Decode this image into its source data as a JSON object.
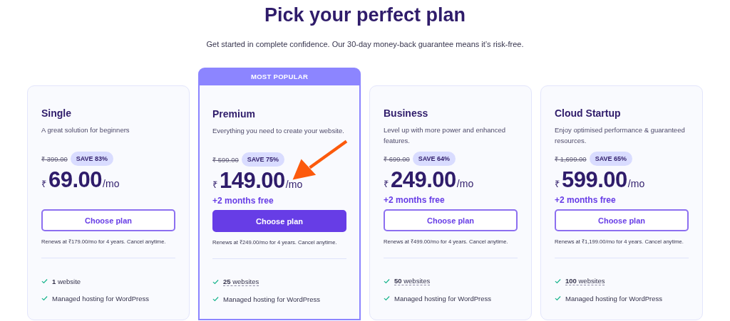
{
  "title": "Pick your perfect plan",
  "subtitle": "Get started in complete confidence. Our 30-day money-back guarantee means it’s risk-free.",
  "plans": [
    {
      "name": "Single",
      "popular": false,
      "description": "A great solution for beginners",
      "old_price": "₹ 399.00",
      "save": "SAVE 83%",
      "currency": "₹",
      "price": "69.00",
      "period": "/mo",
      "button": "Choose plan",
      "renews": "Renews at ₹179.00/mo for 4 years. Cancel anytime.",
      "features": [
        {
          "text": "**1** website",
          "underlined": false
        },
        {
          "text": "Managed hosting for WordPress",
          "underlined": false
        }
      ]
    },
    {
      "name": "Premium",
      "popular": true,
      "badge": "MOST POPULAR",
      "description": "Everything you need to create your website.",
      "old_price": "₹ 599.00",
      "save": "SAVE 75%",
      "currency": "₹",
      "price": "149.00",
      "period": "/mo",
      "bonus": "+2 months free",
      "button": "Choose plan",
      "renews": "Renews at ₹249.00/mo for 4 years. Cancel anytime.",
      "features": [
        {
          "text": "**25** websites",
          "underlined": true
        },
        {
          "text": "Managed hosting for WordPress",
          "underlined": false
        }
      ]
    },
    {
      "name": "Business",
      "popular": false,
      "description": "Level up with more power and enhanced features.",
      "old_price": "₹ 699.00",
      "save": "SAVE 64%",
      "currency": "₹",
      "price": "249.00",
      "period": "/mo",
      "bonus": "+2 months free",
      "button": "Choose plan",
      "renews": "Renews at ₹499.00/mo for 4 years. Cancel anytime.",
      "features": [
        {
          "text": "**50** websites",
          "underlined": true
        },
        {
          "text": "Managed hosting for WordPress",
          "underlined": false
        }
      ]
    },
    {
      "name": "Cloud Startup",
      "popular": false,
      "description": "Enjoy optimised performance & guaranteed resources.",
      "old_price": "₹ 1,699.00",
      "save": "SAVE 65%",
      "currency": "₹",
      "price": "599.00",
      "period": "/mo",
      "bonus": "+2 months free",
      "button": "Choose plan",
      "renews": "Renews at ₹1,199.00/mo for 4 years. Cancel anytime.",
      "features": [
        {
          "text": "**100** websites",
          "underlined": true
        },
        {
          "text": "Managed hosting for WordPress",
          "underlined": false
        }
      ]
    }
  ]
}
